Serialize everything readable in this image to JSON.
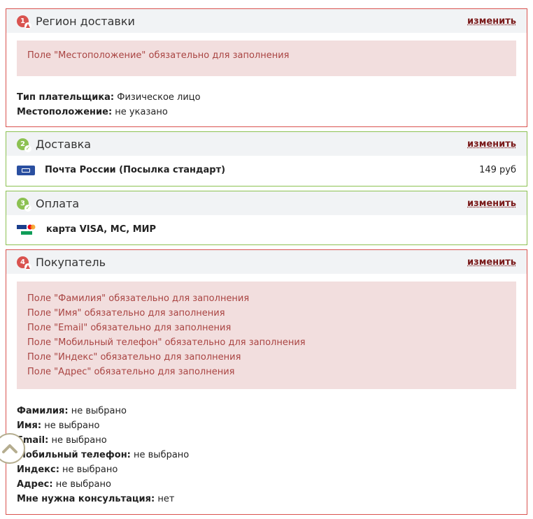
{
  "region": {
    "step": "1",
    "title": "Регион доставки",
    "change_label": "изменить",
    "alert": "Поле \"Местоположение\" обязательно для заполнения",
    "fields": [
      {
        "label": "Тип плательщика:",
        "value": "Физическое лицо"
      },
      {
        "label": "Местоположение:",
        "value": "не указано"
      }
    ]
  },
  "delivery": {
    "step": "2",
    "title": "Доставка",
    "change_label": "изменить",
    "service_name": "Почта России (Посылка стандарт)",
    "price": "149 руб",
    "logo_icon": "russian-post-logo-icon"
  },
  "payment": {
    "step": "3",
    "title": "Оплата",
    "change_label": "изменить",
    "method_name": "карта VISA, MC, МИР",
    "logo_icon": "card-payment-logo-icon"
  },
  "buyer": {
    "step": "4",
    "title": "Покупатель",
    "change_label": "изменить",
    "alerts": [
      "Поле \"Фамилия\" обязательно для заполнения",
      "Поле \"Имя\" обязательно для заполнения",
      "Поле \"Email\" обязательно для заполнения",
      "Поле \"Мобильный телефон\" обязательно для заполнения",
      "Поле \"Индекс\" обязательно для заполнения",
      "Поле \"Адрес\" обязательно для заполнения"
    ],
    "fields": [
      {
        "label": "Фамилия:",
        "value": "не выбрано"
      },
      {
        "label": "Имя:",
        "value": "не выбрано"
      },
      {
        "label": "Email:",
        "value": "не выбрано"
      },
      {
        "label": "Мобильный телефон:",
        "value": "не выбрано"
      },
      {
        "label": "Индекс:",
        "value": "не выбрано"
      },
      {
        "label": "Адрес:",
        "value": "не выбрано"
      },
      {
        "label": "Мне нужна консультация:",
        "value": "нет"
      }
    ]
  },
  "colors": {
    "error_border": "#d9534f",
    "ok_border": "#8cc152",
    "alert_bg": "#f2dede",
    "alert_text": "#a94442",
    "link": "#7a1a1a"
  },
  "scroll_up_icon": "chevron-up-icon"
}
